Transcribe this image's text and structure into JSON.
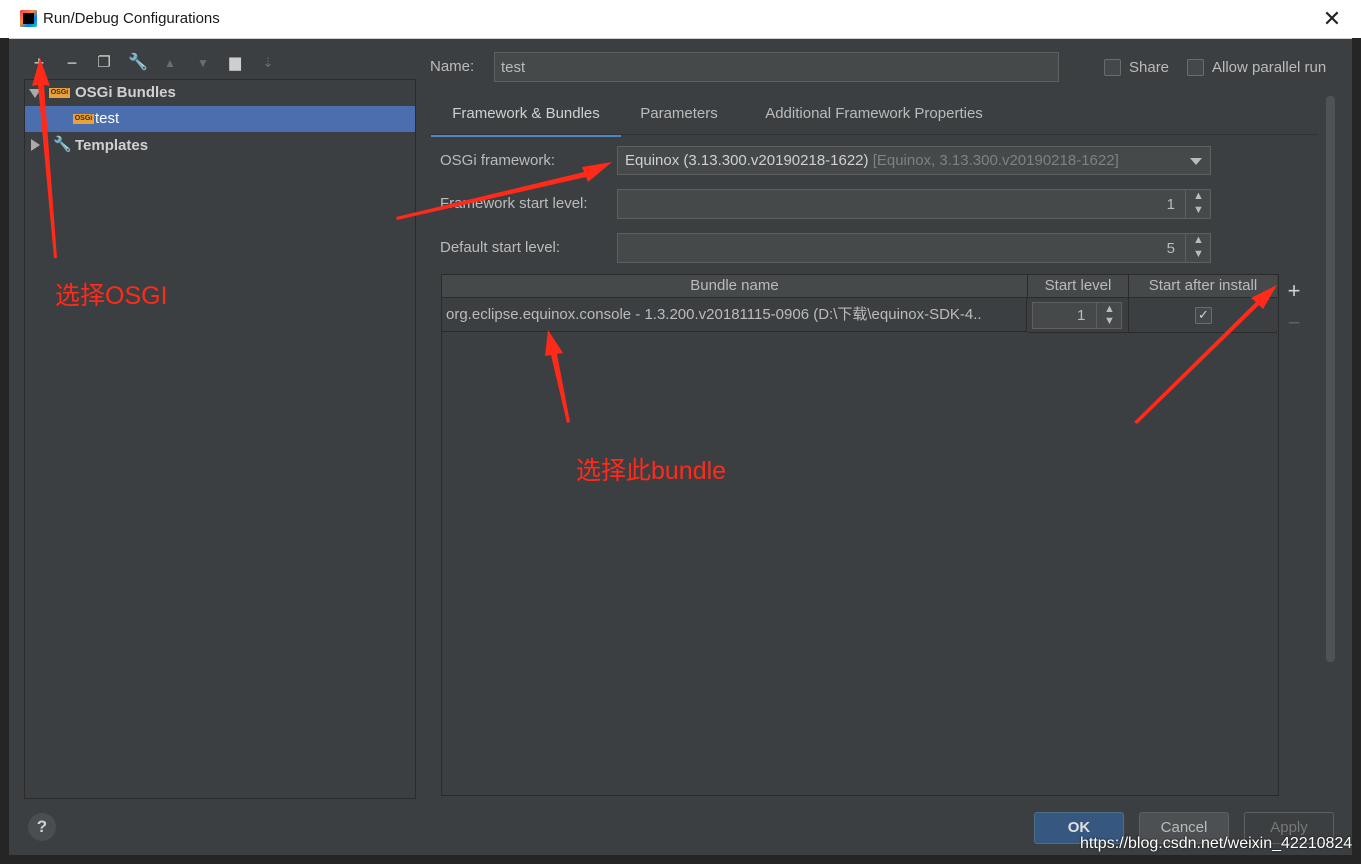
{
  "window": {
    "title": "Run/Debug Configurations",
    "close_label": "✕"
  },
  "tree": {
    "group_label": "OSGi Bundles",
    "badge_text": "OSGi",
    "child_label": "test",
    "templates_label": "Templates"
  },
  "name_field": {
    "label": "Name:",
    "value": "test"
  },
  "options": {
    "share_label": "Share",
    "parallel_label": "Allow parallel run"
  },
  "tabs": [
    {
      "label": "Framework & Bundles",
      "active": true
    },
    {
      "label": "Parameters",
      "active": false
    },
    {
      "label": "Additional Framework Properties",
      "active": false
    }
  ],
  "framework": {
    "label": "OSGi framework:",
    "value": "Equinox (3.13.300.v20190218-1622)",
    "value_hint": "[Equinox, 3.13.300.v20190218-1622]"
  },
  "framework_start_level": {
    "label": "Framework start level:",
    "value": "1"
  },
  "default_start_level": {
    "label": "Default start level:",
    "value": "5"
  },
  "bundles_table": {
    "columns": [
      "Bundle name",
      "Start level",
      "Start after install"
    ],
    "rows": [
      {
        "name": "org.eclipse.equinox.console - 1.3.200.v20181115-0906 (D:\\下载\\equinox-SDK-4..",
        "start_level": "1",
        "start_after_install": true
      }
    ],
    "add_label": "+",
    "remove_label": "−"
  },
  "buttons": {
    "ok": "OK",
    "cancel": "Cancel",
    "apply": "Apply",
    "help": "?"
  },
  "annotations": {
    "select_osgi": "选择OSGI",
    "select_bundle": "选择此bundle"
  },
  "watermark": "https://blog.csdn.net/weixin_42210824",
  "colors": {
    "accent": "#4b6eaf",
    "annotation": "#ff2a1a",
    "background": "#3c3f41"
  }
}
